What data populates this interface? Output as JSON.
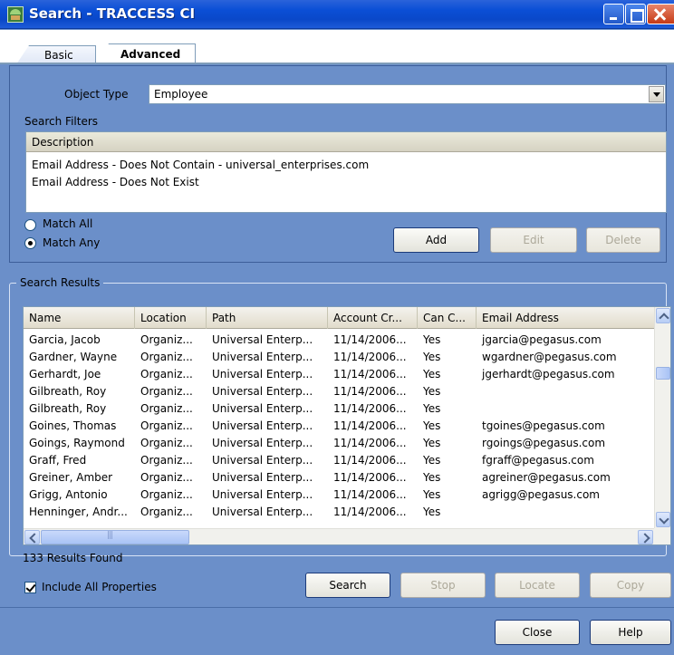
{
  "window": {
    "title": "Search - TRACCESS CI"
  },
  "tabs": [
    {
      "label": "Basic",
      "active": false
    },
    {
      "label": "Advanced",
      "active": true
    }
  ],
  "object_type": {
    "label": "Object Type",
    "value": "Employee"
  },
  "search_filters": {
    "label": "Search Filters",
    "column": "Description",
    "rows": [
      "Email Address - Does Not Contain - universal_enterprises.com",
      "Email Address - Does Not Exist"
    ]
  },
  "match": {
    "all_label": "Match All",
    "any_label": "Match Any",
    "selected": "any"
  },
  "filter_buttons": {
    "add": "Add",
    "edit": "Edit",
    "delete": "Delete"
  },
  "results": {
    "label": "Search Results",
    "columns": [
      "Name",
      "Location",
      "Path",
      "Account Cr...",
      "Can C...",
      "Email Address"
    ],
    "rows": [
      [
        "Garcia, Jacob",
        "Organiz...",
        "Universal Enterp...",
        "11/14/2006...",
        "Yes",
        "jgarcia@pegasus.com"
      ],
      [
        "Gardner, Wayne",
        "Organiz...",
        "Universal Enterp...",
        "11/14/2006...",
        "Yes",
        "wgardner@pegasus.com"
      ],
      [
        "Gerhardt, Joe",
        "Organiz...",
        "Universal Enterp...",
        "11/14/2006...",
        "Yes",
        "jgerhardt@pegasus.com"
      ],
      [
        "Gilbreath, Roy",
        "Organiz...",
        "Universal Enterp...",
        "11/14/2006...",
        "Yes",
        ""
      ],
      [
        "Gilbreath, Roy",
        "Organiz...",
        "Universal Enterp...",
        "11/14/2006...",
        "Yes",
        ""
      ],
      [
        "Goines, Thomas",
        "Organiz...",
        "Universal Enterp...",
        "11/14/2006...",
        "Yes",
        "tgoines@pegasus.com"
      ],
      [
        "Goings, Raymond",
        "Organiz...",
        "Universal Enterp...",
        "11/14/2006...",
        "Yes",
        "rgoings@pegasus.com"
      ],
      [
        "Graff, Fred",
        "Organiz...",
        "Universal Enterp...",
        "11/14/2006...",
        "Yes",
        "fgraff@pegasus.com"
      ],
      [
        "Greiner, Amber",
        "Organiz...",
        "Universal Enterp...",
        "11/14/2006...",
        "Yes",
        "agreiner@pegasus.com"
      ],
      [
        "Grigg, Antonio",
        "Organiz...",
        "Universal Enterp...",
        "11/14/2006...",
        "Yes",
        "agrigg@pegasus.com"
      ],
      [
        "Henninger, Andr...",
        "Organiz...",
        "Universal Enterp...",
        "11/14/2006...",
        "Yes",
        ""
      ]
    ],
    "count_text": "133 Results Found"
  },
  "include_all": {
    "label": "Include All Properties",
    "checked": true
  },
  "result_buttons": {
    "search": "Search",
    "stop": "Stop",
    "locate": "Locate",
    "copy": "Copy"
  },
  "footer_buttons": {
    "close": "Close",
    "help": "Help"
  },
  "colors": {
    "panel": "#6b8fc9",
    "title_bar": "#0b4fd6",
    "disabled_text": "#aca899"
  }
}
